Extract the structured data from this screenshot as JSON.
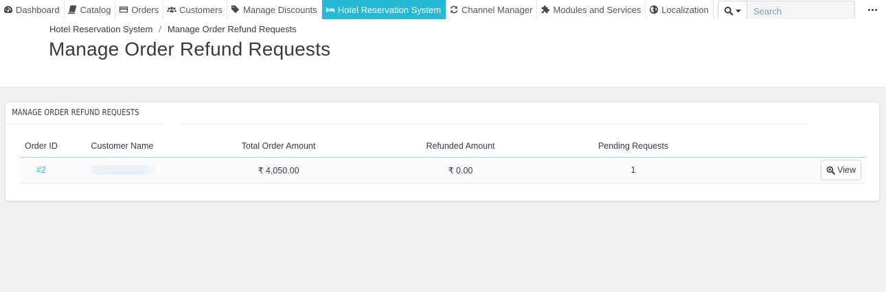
{
  "nav": {
    "items": [
      {
        "label": "Dashboard",
        "icon": "dashboard-icon",
        "active": false
      },
      {
        "label": "Catalog",
        "icon": "book-icon",
        "active": false
      },
      {
        "label": "Orders",
        "icon": "credit-card-icon",
        "active": false
      },
      {
        "label": "Customers",
        "icon": "users-icon",
        "active": false
      },
      {
        "label": "Manage Discounts",
        "icon": "tags-icon",
        "active": false
      },
      {
        "label": "Hotel Reservation System",
        "icon": "bed-icon",
        "active": true
      },
      {
        "label": "Channel Manager",
        "icon": "refresh-icon",
        "active": false
      },
      {
        "label": "Modules and Services",
        "icon": "puzzle-icon",
        "active": false
      },
      {
        "label": "Localization",
        "icon": "globe-icon",
        "active": false
      }
    ]
  },
  "search": {
    "placeholder": "Search",
    "value": ""
  },
  "colors": {
    "accent": "#25b9d7",
    "text": "#363a41",
    "background": "#eff1f2"
  },
  "breadcrumb": {
    "parent": "Hotel Reservation System",
    "separator": "/",
    "current": "Manage Order Refund Requests"
  },
  "page_title": "Manage Order Refund Requests",
  "panel": {
    "heading": "Manage Order Refund Requests",
    "columns": {
      "order_id": "Order ID",
      "customer_name": "Customer Name",
      "total_order_amount": "Total Order Amount",
      "refunded_amount": "Refunded Amount",
      "pending_requests": "Pending Requests"
    },
    "rows": [
      {
        "order_id": "#2",
        "customer_name": "",
        "total_order_amount": "₹ 4,050.00",
        "refunded_amount": "₹ 0.00",
        "pending_requests": "1",
        "action_label": "View"
      }
    ]
  }
}
